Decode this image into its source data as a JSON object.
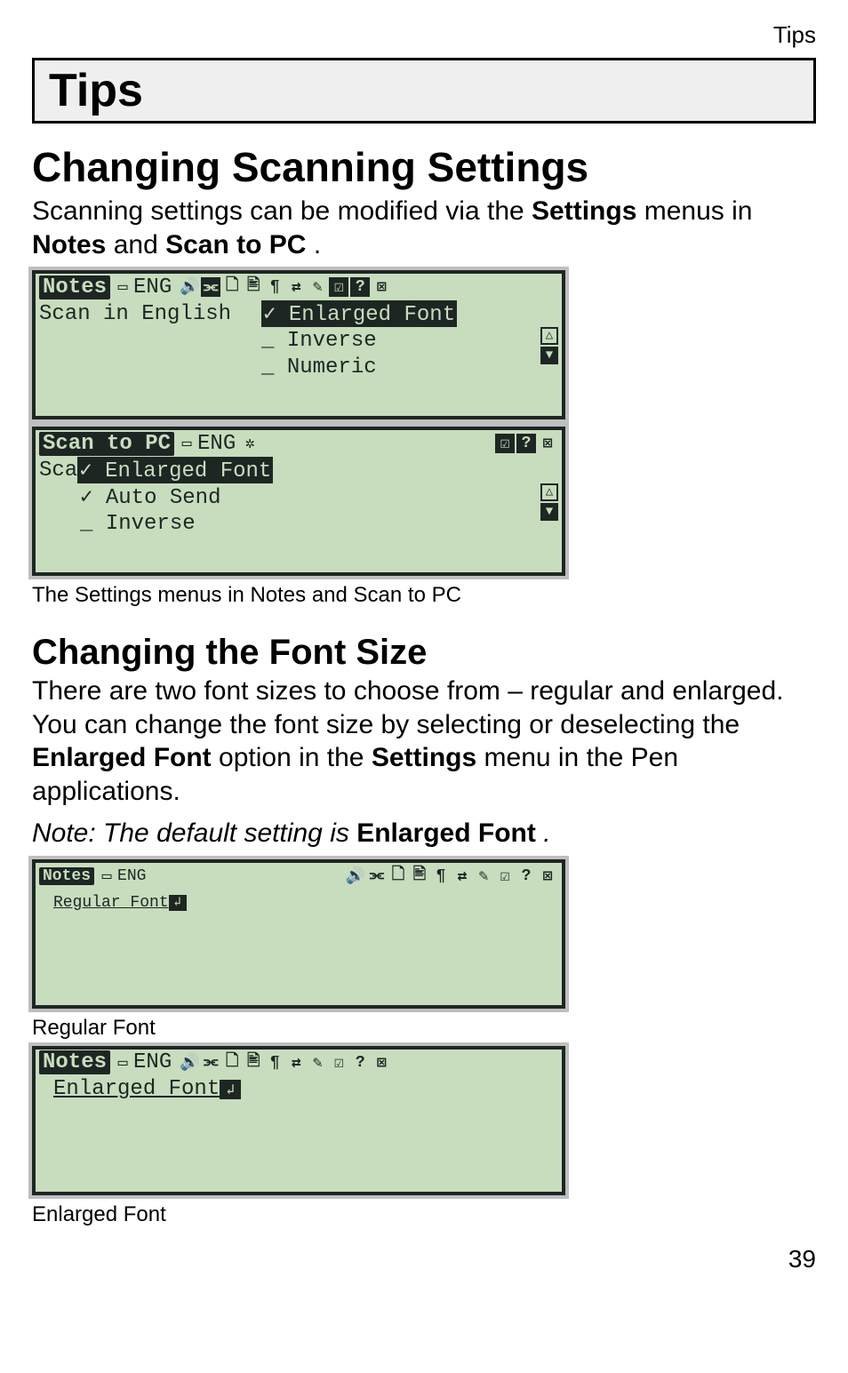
{
  "header_label": "Tips",
  "banner": "Tips",
  "section_title": "Changing Scanning Settings",
  "intro_a": "Scanning settings can be modified via the ",
  "intro_b": "Settings",
  "intro_c": " menus in ",
  "intro_d": "Notes",
  "intro_e": " and ",
  "intro_f": "Scan to PC",
  "intro_g": ".",
  "lcd1": {
    "app": "Notes",
    "lang": "ENG",
    "line": "Scan in English",
    "menu": [
      "Enlarged Font",
      "Inverse",
      "Numeric"
    ],
    "checks": [
      "✓",
      "_",
      "_"
    ]
  },
  "lcd2": {
    "app": "Scan to PC",
    "lang": "ENG",
    "prefix": "Sca",
    "menu": [
      "Enlarged Font",
      "Auto Send",
      "Inverse"
    ],
    "checks": [
      "✓",
      "✓",
      "_"
    ]
  },
  "caption1": "The Settings menus in Notes and Scan to PC",
  "sub_title": "Changing the Font Size",
  "para2_a": "There are two font sizes to choose from – regular and enlarged. You can change the font size by selecting or deselecting the ",
  "para2_b": "Enlarged Font",
  "para2_c": " option in the ",
  "para2_d": "Settings",
  "para2_e": " menu in the Pen applications.",
  "note_a": "Note: The default setting is ",
  "note_b": "Enlarged Font",
  "note_c": ".",
  "lcd3": {
    "app": "Notes",
    "lang": "ENG",
    "text": "Regular Font"
  },
  "caption_reg": "Regular Font",
  "lcd4": {
    "app": "Notes",
    "lang": "ENG",
    "text": "Enlarged Font"
  },
  "caption_enl": "Enlarged Font",
  "page_number": "39",
  "glyph": {
    "batt": "▭",
    "speaker": "🔊",
    "link": "⫘",
    "page": "🗋",
    "copy": "🖹",
    "pilcrow": "¶",
    "swap": "⇄",
    "pencil": "✎",
    "check": "☑",
    "checkinv": "☑",
    "help": "?",
    "close": "⊠",
    "up": "△",
    "down": "▼",
    "enter": "↲"
  }
}
